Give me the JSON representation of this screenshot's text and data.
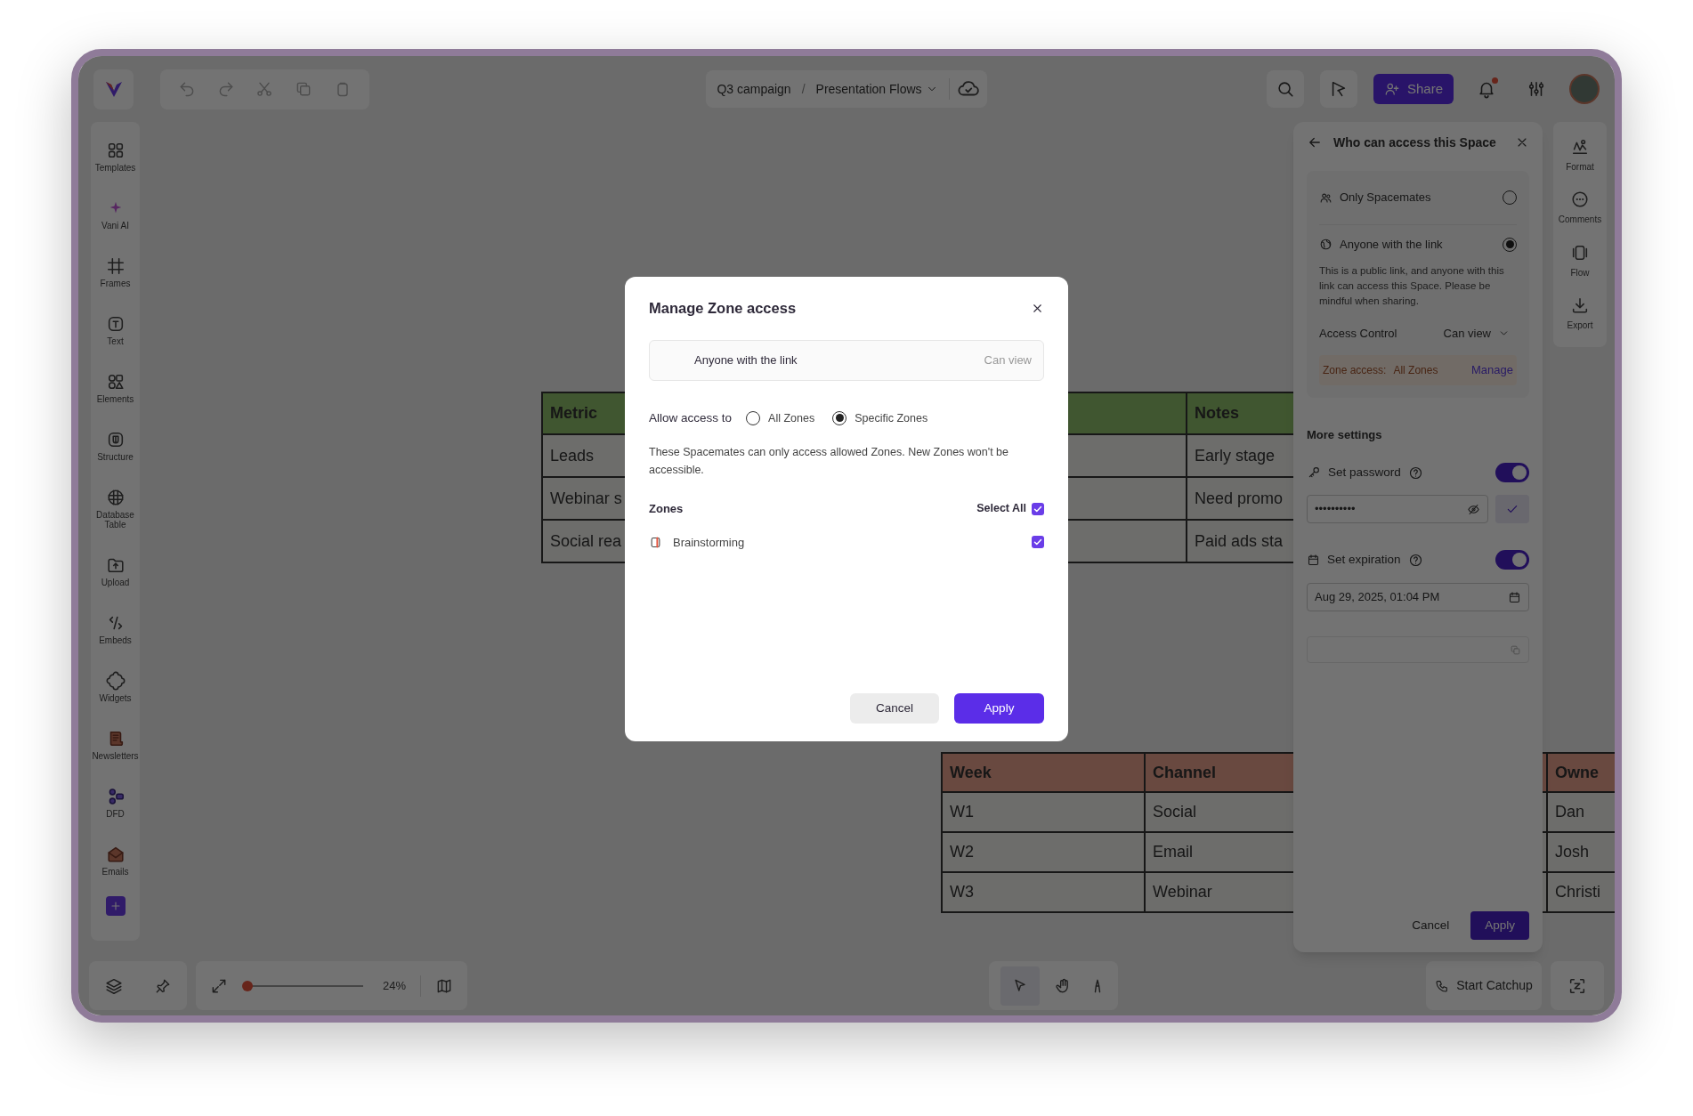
{
  "topbar": {
    "breadcrumb": [
      "Q3 campaign",
      "Presentation Flows"
    ],
    "separator": "/",
    "share_button": "Share"
  },
  "sidebar": {
    "items": [
      {
        "label": "Templates"
      },
      {
        "label": "Vani AI"
      },
      {
        "label": "Frames"
      },
      {
        "label": "Text"
      },
      {
        "label": "Elements"
      },
      {
        "label": "Structure"
      },
      {
        "label": "Database Table"
      },
      {
        "label": "Upload"
      },
      {
        "label": "Embeds"
      },
      {
        "label": "Widgets"
      },
      {
        "label": "Newsletters"
      },
      {
        "label": "DFD"
      },
      {
        "label": "Emails"
      }
    ]
  },
  "canvas": {
    "tables": [
      {
        "header": [
          "Metric",
          "Notes"
        ],
        "rows": [
          [
            "Leads",
            "Early stage"
          ],
          [
            "Webinar s",
            "Need promo"
          ],
          [
            "Social rea",
            "Paid ads sta"
          ]
        ]
      },
      {
        "header": [
          "Week",
          "Channel",
          "Owne"
        ],
        "rows": [
          [
            "W1",
            "Social",
            "Dan"
          ],
          [
            "W2",
            "Email",
            "Josh"
          ],
          [
            "W3",
            "Webinar",
            "Christi"
          ]
        ]
      }
    ]
  },
  "right_toolbar": [
    {
      "label": "Format"
    },
    {
      "label": "Comments"
    },
    {
      "label": "Flow"
    },
    {
      "label": "Export"
    }
  ],
  "share_panel": {
    "title": "Who can access this Space",
    "options": [
      {
        "label": "Only Spacemates",
        "selected": false
      },
      {
        "label": "Anyone with the link",
        "selected": true,
        "description": "This is a public link, and anyone with this link can access this Space. Please be mindful when sharing."
      }
    ],
    "access_control": {
      "label": "Access Control",
      "value": "Can view"
    },
    "zone_access": {
      "label": "Zone access:",
      "value": "All Zones",
      "action": "Manage"
    },
    "more_settings": "More settings",
    "password": {
      "label": "Set password",
      "on": true,
      "value": "••••••••••"
    },
    "expiration": {
      "label": "Set expiration",
      "on": true,
      "value": "Aug 29, 2025, 01:04 PM"
    },
    "buttons": [
      "Cancel",
      "Apply"
    ]
  },
  "bottom_bar": {
    "zoom": {
      "level": 0,
      "reading": "24%"
    },
    "catchup_button": "Start Catchup"
  },
  "modal": {
    "title": "Manage Zone access",
    "access": {
      "label": "Anyone with the link",
      "permission": "Can view"
    },
    "allow_label": "Allow access to",
    "options": [
      {
        "label": "All Zones",
        "selected": false
      },
      {
        "label": "Specific Zones",
        "selected": true
      }
    ],
    "description": "These Spacemates can only access allowed Zones. New Zones won't be accessible.",
    "zones_heading": "Zones",
    "select_all": {
      "label": "Select All",
      "checked": true
    },
    "zones": [
      {
        "label": "Brainstorming",
        "checked": true
      }
    ],
    "buttons": [
      "Cancel",
      "Apply"
    ]
  }
}
